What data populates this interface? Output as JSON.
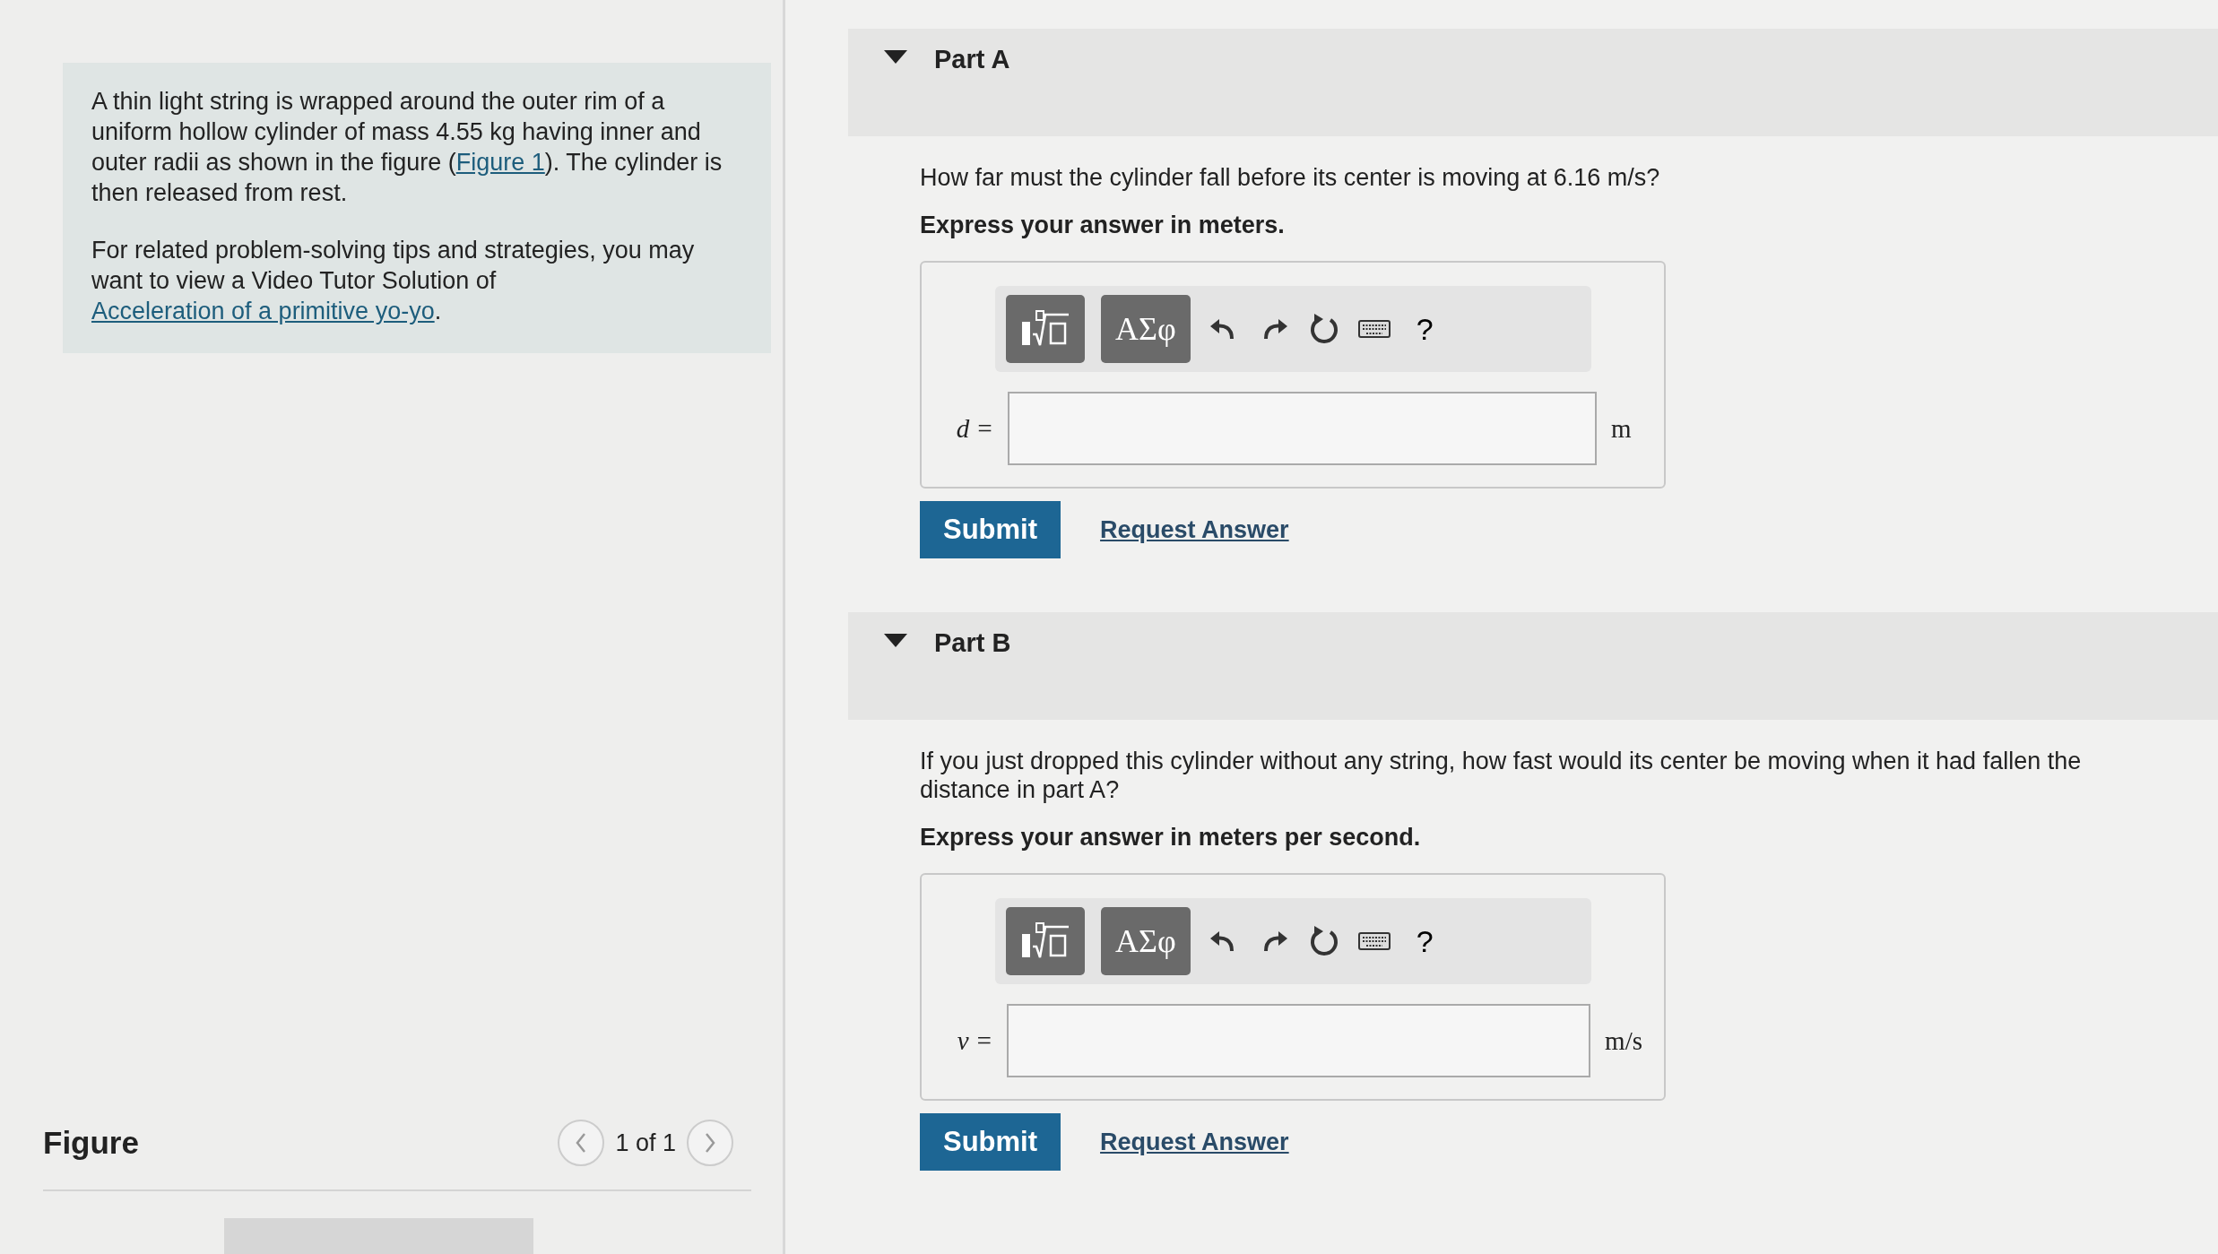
{
  "problem": {
    "paragraph_1": {
      "before": "A thin light string is wrapped around the outer rim of a uniform hollow cylinder of mass 4.55 kg having inner and outer radii as shown in the figure (",
      "link": "Figure 1",
      "after": "). The cylinder is then released from rest."
    },
    "paragraph_2": {
      "before": "For related problem-solving tips and strategies, you may want to view a Video Tutor Solution of ",
      "link": "Acceleration of a primitive yo-yo",
      "after": "."
    }
  },
  "figure": {
    "title": "Figure",
    "page": "1 of 1"
  },
  "parts": [
    {
      "title": "Part A",
      "expanded": true,
      "question": "How far must the cylinder fall before its center is moving at 6.16 m/s?",
      "instruction": "Express your answer in meters.",
      "symbols_button": "ΑΣφ",
      "help_button": "?",
      "variable": "d =",
      "unit": "m",
      "submit": "Submit",
      "request": "Request Answer"
    },
    {
      "title": "Part B",
      "expanded": true,
      "question": "If you just dropped this cylinder without any string, how fast would its center be moving when it had fallen the distance in part A?",
      "instruction": "Express your answer in meters per second.",
      "symbols_button": "ΑΣφ",
      "help_button": "?",
      "variable": "v =",
      "unit": "m/s",
      "submit": "Submit",
      "request": "Request Answer"
    }
  ]
}
